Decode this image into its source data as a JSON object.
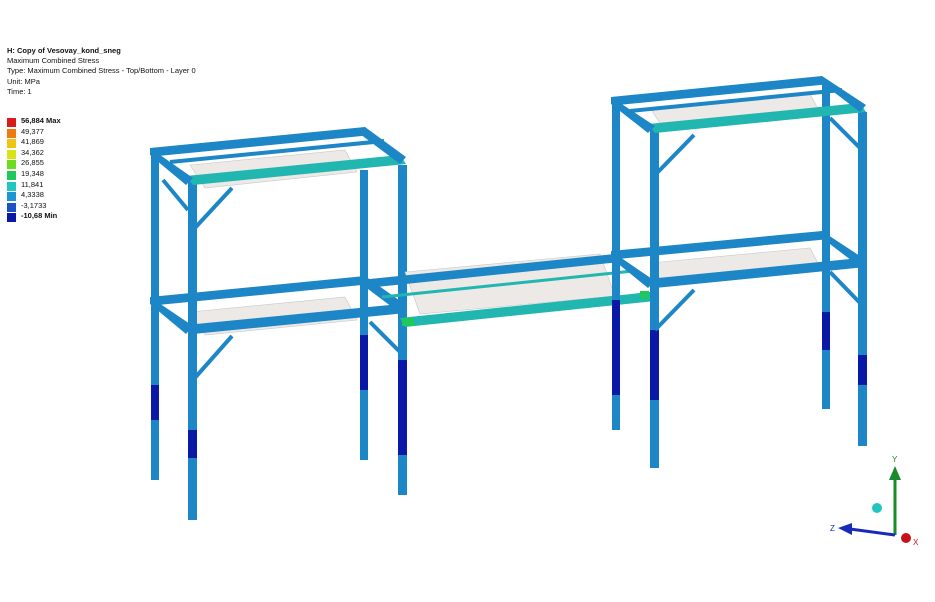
{
  "header": {
    "title": "H: Copy of Vesovay_kond_sneg",
    "result": "Maximum Combined Stress",
    "type": "Type: Maximum Combined Stress - Top/Bottom - Layer 0",
    "unit": "Unit: MPa",
    "time": "Time: 1"
  },
  "legend": [
    {
      "label": "56,884 Max",
      "color": "#d81b1b",
      "bold": true
    },
    {
      "label": "49,377",
      "color": "#f07a12",
      "bold": false
    },
    {
      "label": "41,869",
      "color": "#f0c412",
      "bold": false
    },
    {
      "label": "34,362",
      "color": "#d6e614",
      "bold": false
    },
    {
      "label": "26,855",
      "color": "#6cdc1e",
      "bold": false
    },
    {
      "label": "19,348",
      "color": "#1fc85a",
      "bold": false
    },
    {
      "label": "11,841",
      "color": "#1fc6c2",
      "bold": false
    },
    {
      "label": "4,3338",
      "color": "#1c95d6",
      "bold": false
    },
    {
      "label": "-3,1733",
      "color": "#1c52c8",
      "bold": false
    },
    {
      "label": "-10,68 Min",
      "color": "#0a18a8",
      "bold": true
    }
  ],
  "triad": {
    "x_label": "X",
    "y_label": "Y",
    "z_label": "Z",
    "x_color": "#c8101a",
    "y_color": "#1a8a2a",
    "z_color": "#1a2ab8"
  }
}
